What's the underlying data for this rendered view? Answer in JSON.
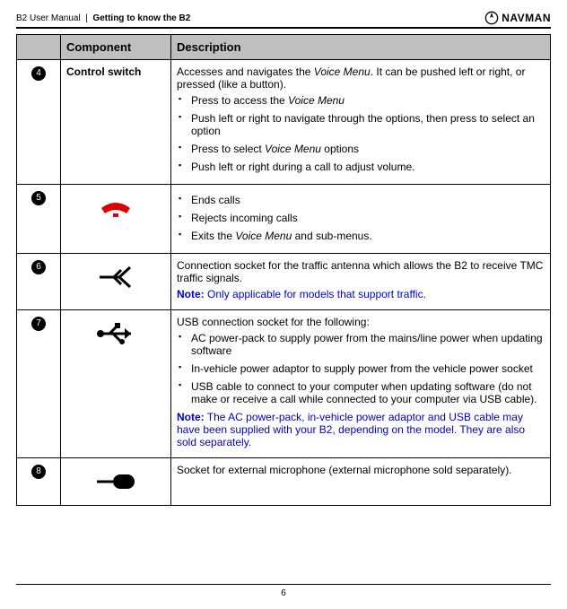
{
  "header": {
    "doc": "B2 User Manual",
    "section": "Getting to know the B2",
    "brand": "NAVMAN"
  },
  "table": {
    "head": {
      "c1": "",
      "c2": "Component",
      "c3": "Description"
    },
    "rows": [
      {
        "num": "4",
        "component": "Control switch",
        "icon": "",
        "desc": {
          "intro": "Accesses and navigates the Voice Menu. It can be pushed left or right, or pressed (like a button).",
          "items": [
            "Press to access the Voice Menu",
            "Push left or right to navigate through the options, then press to select an option",
            "Press to select Voice Menu options",
            "Push left or right during a call to adjust volume."
          ]
        }
      },
      {
        "num": "5",
        "component": "",
        "icon": "hangup",
        "desc": {
          "items": [
            "Ends calls",
            "Rejects incoming calls",
            "Exits the Voice Menu and sub-menus."
          ]
        }
      },
      {
        "num": "6",
        "component": "",
        "icon": "antenna",
        "desc": {
          "intro": "Connection socket for the traffic antenna which allows the B2 to receive TMC traffic signals.",
          "note": "Only applicable for models that support traffic."
        }
      },
      {
        "num": "7",
        "component": "",
        "icon": "usb",
        "desc": {
          "intro": "USB connection socket for the following:",
          "items": [
            "AC power-pack to supply power from the mains/line power when updating software",
            "In-vehicle power adaptor to supply power from the vehicle power socket",
            "USB cable to connect to your computer when updating software (do not make or receive a call while connected to your computer via USB cable)."
          ],
          "note": "The AC power-pack, in-vehicle power adaptor and USB cable may have been supplied with your B2, depending on the model. They are also sold separately."
        }
      },
      {
        "num": "8",
        "component": "",
        "icon": "mic",
        "desc": {
          "intro": "Socket for external microphone (external microphone sold separately)."
        }
      }
    ]
  },
  "footer": {
    "page": "6"
  }
}
